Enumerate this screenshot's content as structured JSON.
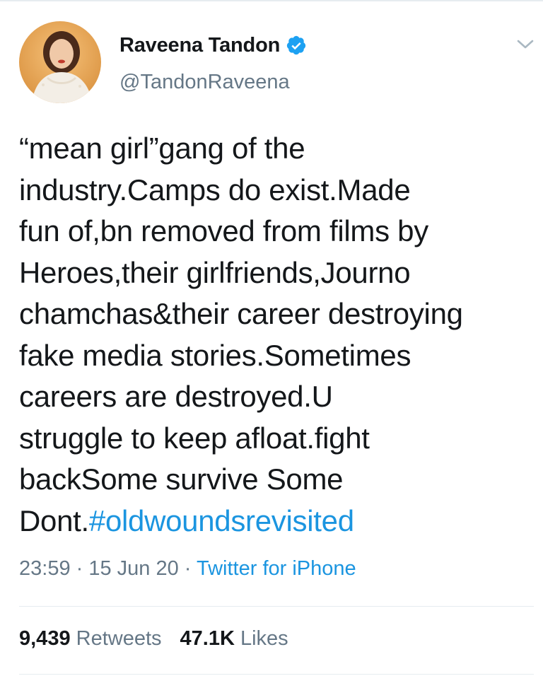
{
  "author": {
    "display_name": "Raveena Tandon",
    "handle": "@TandonRaveena",
    "verified": true
  },
  "tweet": {
    "text": "“mean girl”gang of the\nindustry.Camps do exist.Made\nfun of,bn removed from films by\nHeroes,their girlfriends,Journo\nchamchas&their career destroying\nfake media stories.Sometimes\ncareers are destroyed.U\nstruggle to keep afloat.fight\nbackSome survive Some\nDont.",
    "hashtag": "#oldwoundsrevisited"
  },
  "meta": {
    "time": "23:59",
    "separator": " · ",
    "date": "15 Jun 20",
    "source": "Twitter for iPhone"
  },
  "stats": {
    "retweets_count": "9,439",
    "retweets_label": "Retweets",
    "likes_count": "47.1K",
    "likes_label": "Likes"
  },
  "icons": {
    "verified": "verified-badge-icon",
    "chevron": "chevron-down-icon",
    "avatar": "profile-photo"
  },
  "colors": {
    "link": "#1b95e0",
    "secondary_text": "#657786",
    "primary_text": "#14171a",
    "divider": "#e6ecf0"
  }
}
